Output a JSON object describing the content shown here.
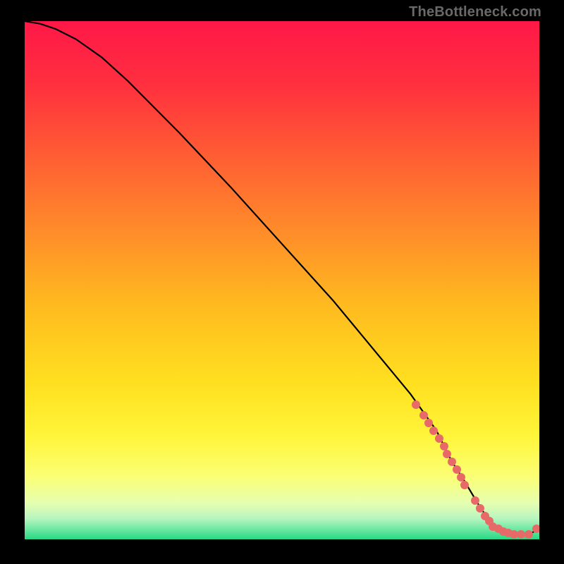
{
  "attribution": "TheBottleneck.com",
  "colors": {
    "marker": "#e86a68",
    "curve": "#000000",
    "gradient_stops": [
      {
        "pct": 0,
        "color": "#ff1847"
      },
      {
        "pct": 12,
        "color": "#ff2f3f"
      },
      {
        "pct": 25,
        "color": "#ff5a34"
      },
      {
        "pct": 40,
        "color": "#ff8a2a"
      },
      {
        "pct": 55,
        "color": "#ffbb1f"
      },
      {
        "pct": 70,
        "color": "#ffe020"
      },
      {
        "pct": 80,
        "color": "#fff53a"
      },
      {
        "pct": 88,
        "color": "#fbff76"
      },
      {
        "pct": 93,
        "color": "#e6ffb0"
      },
      {
        "pct": 96,
        "color": "#b7f5c0"
      },
      {
        "pct": 98,
        "color": "#6fe8a3"
      },
      {
        "pct": 100,
        "color": "#27d885"
      }
    ]
  },
  "chart_data": {
    "type": "line",
    "title": "",
    "xlabel": "",
    "ylabel": "",
    "xlim": [
      0,
      100
    ],
    "ylim": [
      0,
      100
    ],
    "series": [
      {
        "name": "bottleneck-curve",
        "x": [
          0,
          3,
          6,
          10,
          15,
          20,
          30,
          40,
          50,
          60,
          70,
          75,
          80,
          83,
          85,
          88,
          90,
          92,
          95,
          98,
          100
        ],
        "y": [
          100,
          99.5,
          98.5,
          96.5,
          93,
          88.5,
          78.5,
          68,
          57,
          46,
          34,
          28,
          21,
          15,
          12,
          7,
          4,
          2,
          1,
          1,
          2
        ]
      }
    ],
    "markers": {
      "name": "highlight-points",
      "x": [
        76,
        77.5,
        78.5,
        79.5,
        80.5,
        81.5,
        82,
        83,
        84,
        84.8,
        85.5,
        87.5,
        88.5,
        89.5,
        90.3,
        91,
        92,
        93,
        94,
        95,
        96.5,
        98,
        99.5
      ],
      "y": [
        26,
        24,
        22.5,
        21,
        19.5,
        18,
        16.5,
        15,
        13.5,
        12,
        10.5,
        7.5,
        6,
        4.5,
        3.5,
        2.5,
        2,
        1.5,
        1.2,
        1,
        1,
        1,
        2
      ]
    }
  }
}
